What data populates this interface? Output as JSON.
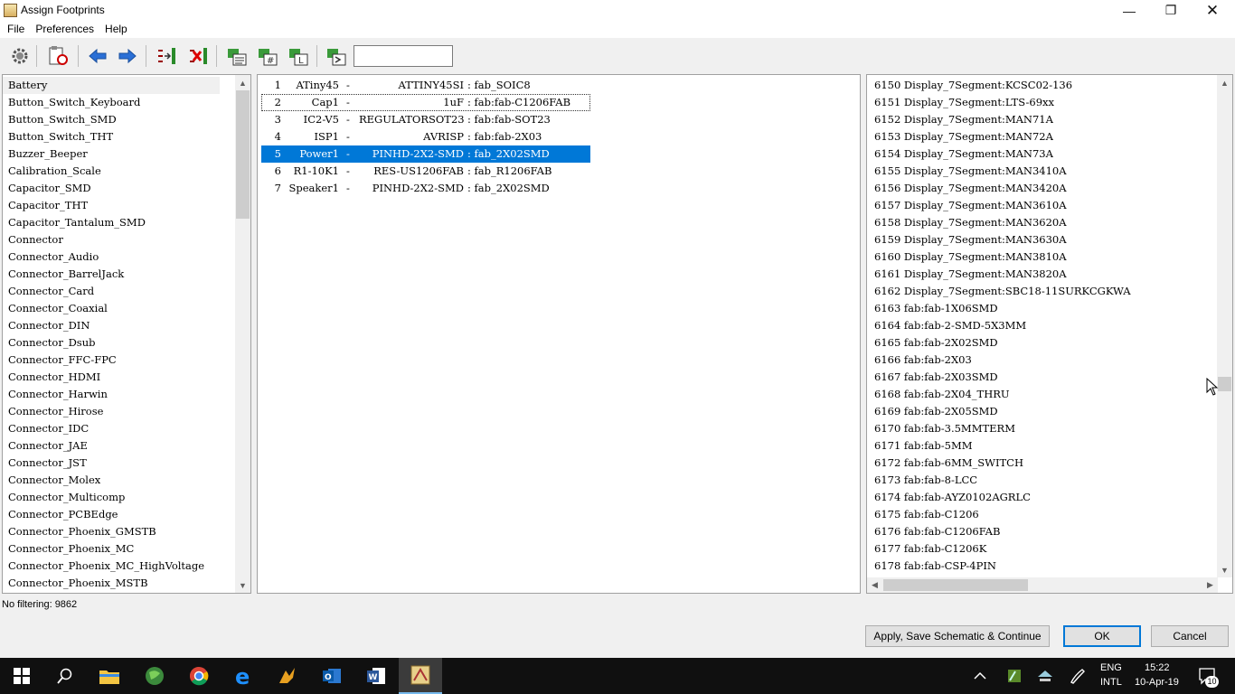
{
  "window": {
    "title": "Assign Footprints",
    "min_glyph": "—",
    "max_glyph": "❐",
    "close_glyph": "✕"
  },
  "menu": [
    "File",
    "Preferences",
    "Help"
  ],
  "toolbar": {
    "filter_value": ""
  },
  "libraries": [
    "Battery",
    "Button_Switch_Keyboard",
    "Button_Switch_SMD",
    "Button_Switch_THT",
    "Buzzer_Beeper",
    "Calibration_Scale",
    "Capacitor_SMD",
    "Capacitor_THT",
    "Capacitor_Tantalum_SMD",
    "Connector",
    "Connector_Audio",
    "Connector_BarrelJack",
    "Connector_Card",
    "Connector_Coaxial",
    "Connector_DIN",
    "Connector_Dsub",
    "Connector_FFC-FPC",
    "Connector_HDMI",
    "Connector_Harwin",
    "Connector_Hirose",
    "Connector_IDC",
    "Connector_JAE",
    "Connector_JST",
    "Connector_Molex",
    "Connector_Multicomp",
    "Connector_PCBEdge",
    "Connector_Phoenix_GMSTB",
    "Connector_Phoenix_MC",
    "Connector_Phoenix_MC_HighVoltage",
    "Connector_Phoenix_MSTB"
  ],
  "components": [
    {
      "num": "1",
      "ref": "ATiny45",
      "dash": "-",
      "value": "ATTINY45SI",
      "footprint": ": fab_SOIC8"
    },
    {
      "num": "2",
      "ref": "Cap1",
      "dash": "-",
      "value": "1uF",
      "footprint": ": fab:fab-C1206FAB"
    },
    {
      "num": "3",
      "ref": "IC2-V5",
      "dash": "-",
      "value": "REGULATORSOT23",
      "footprint": ": fab:fab-SOT23"
    },
    {
      "num": "4",
      "ref": "ISP1",
      "dash": "-",
      "value": "AVRISP",
      "footprint": ": fab:fab-2X03"
    },
    {
      "num": "5",
      "ref": "Power1",
      "dash": "-",
      "value": "PINHD-2X2-SMD",
      "footprint": ": fab_2X02SMD"
    },
    {
      "num": "6",
      "ref": "R1-10K1",
      "dash": "-",
      "value": "RES-US1206FAB",
      "footprint": ": fab_R1206FAB"
    },
    {
      "num": "7",
      "ref": "Speaker1",
      "dash": "-",
      "value": "PINHD-2X2-SMD",
      "footprint": ": fab_2X02SMD"
    }
  ],
  "footprints": [
    "6150 Display_7Segment:KCSC02-136",
    "6151 Display_7Segment:LTS-69xx",
    "6152 Display_7Segment:MAN71A",
    "6153 Display_7Segment:MAN72A",
    "6154 Display_7Segment:MAN73A",
    "6155 Display_7Segment:MAN3410A",
    "6156 Display_7Segment:MAN3420A",
    "6157 Display_7Segment:MAN3610A",
    "6158 Display_7Segment:MAN3620A",
    "6159 Display_7Segment:MAN3630A",
    "6160 Display_7Segment:MAN3810A",
    "6161 Display_7Segment:MAN3820A",
    "6162 Display_7Segment:SBC18-11SURKCGKWA",
    "6163 fab:fab-1X06SMD",
    "6164 fab:fab-2-SMD-5X3MM",
    "6165 fab:fab-2X02SMD",
    "6166 fab:fab-2X03",
    "6167 fab:fab-2X03SMD",
    "6168 fab:fab-2X04_THRU",
    "6169 fab:fab-2X05SMD",
    "6170 fab:fab-3.5MMTERM",
    "6171 fab:fab-5MM",
    "6172 fab:fab-6MM_SWITCH",
    "6173 fab:fab-8-LCC",
    "6174 fab:fab-AYZ0102AGRLC",
    "6175 fab:fab-C1206",
    "6176 fab:fab-C1206FAB",
    "6177 fab:fab-C1206K",
    "6178 fab:fab-CSP-4PIN"
  ],
  "status": {
    "filter_text": "No filtering: 9862"
  },
  "buttons": {
    "apply": "Apply, Save Schematic & Continue",
    "ok": "OK",
    "cancel": "Cancel"
  },
  "taskbar": {
    "lang_top": "ENG",
    "lang_bottom": "INTL",
    "time": "15:22",
    "date": "10-Apr-19",
    "notification_count": "10"
  },
  "colors": {
    "selection": "#0078d7",
    "taskbar": "#101010",
    "ok_border": "#0078d7"
  }
}
